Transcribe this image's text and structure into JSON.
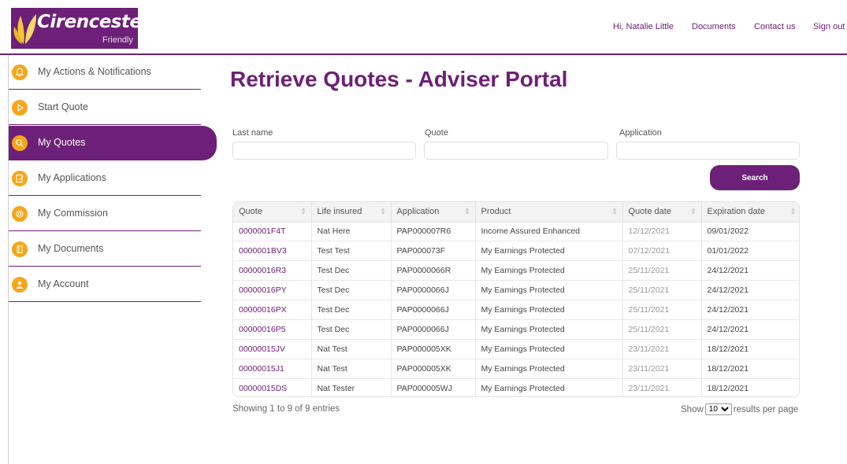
{
  "brand": {
    "name": "Cirencester",
    "tagline": "Friendly",
    "color": "#6d2077",
    "accent": "#f5a61a"
  },
  "header": {
    "greeting": "Hi, Natalie Little",
    "documents": "Documents",
    "contact": "Contact us",
    "signout": "Sign out"
  },
  "sidebar": {
    "items": [
      {
        "label": "My Actions & Notifications",
        "icon": "bell-icon"
      },
      {
        "label": "Start Quote",
        "icon": "play-icon"
      },
      {
        "label": "My Quotes",
        "icon": "search-quote-icon",
        "active": true
      },
      {
        "label": "My Applications",
        "icon": "edit-document-icon"
      },
      {
        "label": "My Commission",
        "icon": "coins-icon"
      },
      {
        "label": "My Documents",
        "icon": "folder-icon"
      },
      {
        "label": "My Account",
        "icon": "user-icon"
      }
    ]
  },
  "page": {
    "title": "Retrieve Quotes - Adviser Portal"
  },
  "search": {
    "lastname_label": "Last name",
    "quote_label": "Quote",
    "application_label": "Application",
    "button": "Search"
  },
  "table": {
    "columns": [
      "Quote",
      "Life insured",
      "Application",
      "Product",
      "Quote date",
      "Expiration date"
    ],
    "rows": [
      [
        "0000001F4T",
        "Nat Here",
        "PAP000007R6",
        "Income Assured Enhanced",
        "12/12/2021",
        "09/01/2022"
      ],
      [
        "0000001BV3",
        "Test Test",
        "PAP000073F",
        "My Earnings Protected",
        "07/12/2021",
        "01/01/2022"
      ],
      [
        "00000016R3",
        "Test Dec",
        "PAP0000066R",
        "My Earnings Protected",
        "25/11/2021",
        "24/12/2021"
      ],
      [
        "00000016PY",
        "Test Dec",
        "PAP0000066J",
        "My Earnings Protected",
        "25/11/2021",
        "24/12/2021"
      ],
      [
        "00000016PX",
        "Test Dec",
        "PAP0000066J",
        "My Earnings Protected",
        "25/11/2021",
        "24/12/2021"
      ],
      [
        "00000016P5",
        "Test Dec",
        "PAP0000066J",
        "My Earnings Protected",
        "25/11/2021",
        "24/12/2021"
      ],
      [
        "00000015JV",
        "Nat Test",
        "PAP000005XK",
        "My Earnings Protected",
        "23/11/2021",
        "18/12/2021"
      ],
      [
        "00000015J1",
        "Nat Test",
        "PAP000005XK",
        "My Earnings Protected",
        "23/11/2021",
        "18/12/2021"
      ],
      [
        "00000015DS",
        "Nat Tester",
        "PAP000005WJ",
        "My Earnings Protected",
        "23/11/2021",
        "18/12/2021"
      ]
    ]
  },
  "footer": {
    "info": "Showing 1 to 9 of 9 entries",
    "show": "Show",
    "page_size": "10",
    "results_suffix": "results per page"
  }
}
